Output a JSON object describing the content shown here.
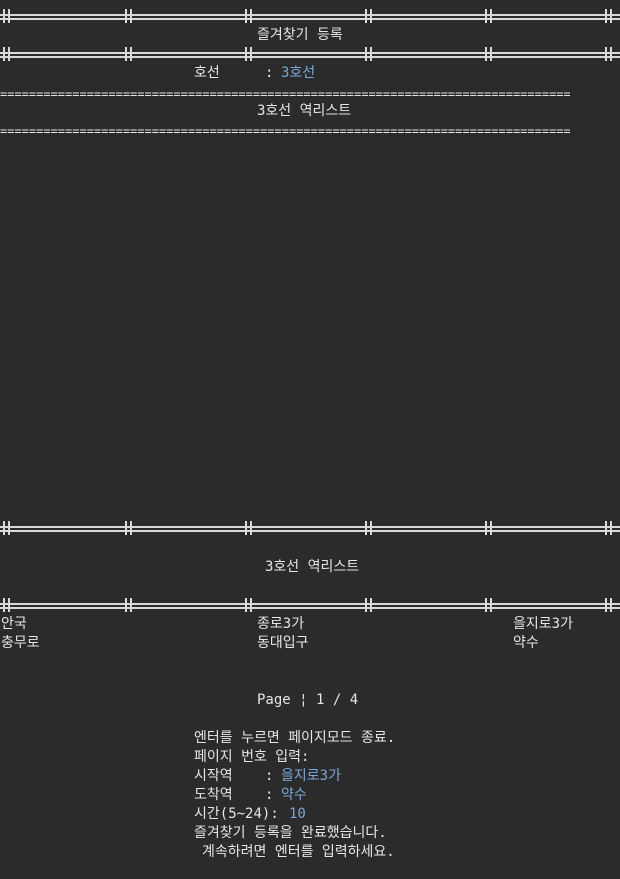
{
  "header": {
    "title": "즐겨찾기 등록",
    "line_label": "호선",
    "line_sep": ":",
    "line_value": "3호선",
    "station_list_title": "3호선 역리스트"
  },
  "list": {
    "title": "3호선 역리스트",
    "rows": [
      [
        "안국",
        "종로3가",
        "을지로3가"
      ],
      [
        "충무로",
        "동대입구",
        "약수"
      ]
    ],
    "page_label": "Page",
    "page_sep": "¦",
    "page_current": "1 / 4"
  },
  "prompts": {
    "enter_hint": "엔터를 누르면 페이지모드 종료.",
    "page_input": "페이지 번호 입력:",
    "start_label": "시작역",
    "start_sep": ":",
    "start_value": "을지로3가",
    "end_label": "도착역",
    "end_sep": ":",
    "end_value": "약수",
    "time_label": "시간(5~24):",
    "time_value": "10",
    "done_msg": "즐겨찾기 등록을 완료했습니다.",
    "continue_msg": "계속하려면 엔터를 입력하세요."
  },
  "colors": {
    "background": "#2b2b2b",
    "text": "#e6e6e6",
    "accent": "#7aa7d8"
  }
}
